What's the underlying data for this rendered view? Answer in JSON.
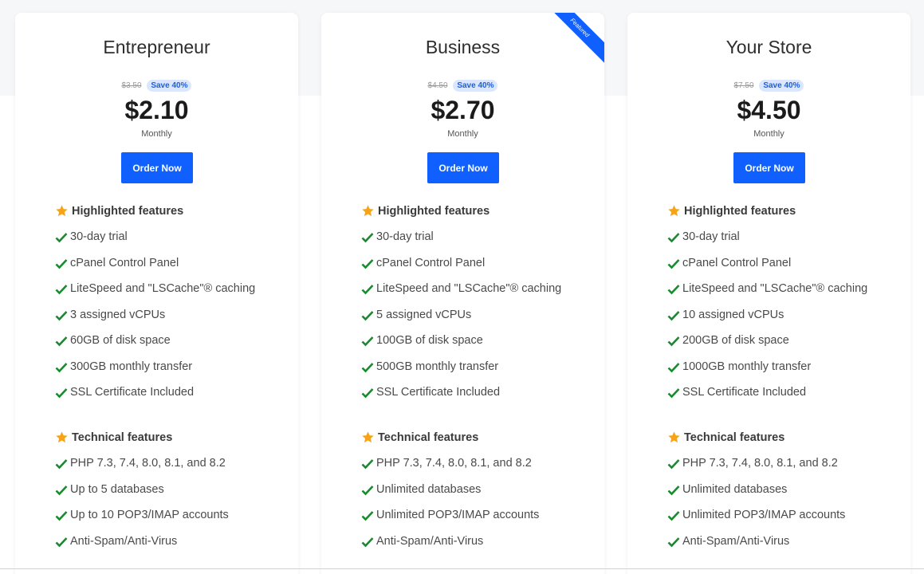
{
  "plans": [
    {
      "name": "Entrepreneur",
      "old_price": "$3.50",
      "save_label": "Save 40%",
      "price": "$2.10",
      "period": "Monthly",
      "order_label": "Order Now",
      "highlighted_title": "Highlighted features",
      "highlighted": [
        "30-day trial",
        "cPanel Control Panel",
        "LiteSpeed and \"LSCache\"® caching",
        "3 assigned vCPUs",
        "60GB of disk space",
        "300GB monthly transfer",
        "SSL Certificate Included"
      ],
      "technical_title": "Technical features",
      "technical": [
        "PHP 7.3, 7.4, 8.0, 8.1, and 8.2",
        "Up to 5 databases",
        "Up to 10 POP3/IMAP accounts",
        "Anti-Spam/Anti-Virus"
      ]
    },
    {
      "name": "Business",
      "ribbon": "Featured",
      "old_price": "$4.50",
      "save_label": "Save 40%",
      "price": "$2.70",
      "period": "Monthly",
      "order_label": "Order Now",
      "highlighted_title": "Highlighted features",
      "highlighted": [
        "30-day trial",
        "cPanel Control Panel",
        "LiteSpeed and \"LSCache\"® caching",
        "5 assigned vCPUs",
        "100GB of disk space",
        "500GB monthly transfer",
        "SSL Certificate Included"
      ],
      "technical_title": "Technical features",
      "technical": [
        "PHP 7.3, 7.4, 8.0, 8.1, and 8.2",
        "Unlimited databases",
        "Unlimited POP3/IMAP accounts",
        "Anti-Spam/Anti-Virus"
      ]
    },
    {
      "name": "Your Store",
      "old_price": "$7.50",
      "save_label": "Save 40%",
      "price": "$4.50",
      "period": "Monthly",
      "order_label": "Order Now",
      "highlighted_title": "Highlighted features",
      "highlighted": [
        "30-day trial",
        "cPanel Control Panel",
        "LiteSpeed and \"LSCache\"® caching",
        "10 assigned vCPUs",
        "200GB of disk space",
        "1000GB monthly transfer",
        "SSL Certificate Included"
      ],
      "technical_title": "Technical features",
      "technical": [
        "PHP 7.3, 7.4, 8.0, 8.1, and 8.2",
        "Unlimited databases",
        "Unlimited POP3/IMAP accounts",
        "Anti-Spam/Anti-Virus"
      ]
    }
  ],
  "icons": {
    "section": "star-icon",
    "feature": "check-icon"
  },
  "colors": {
    "accent": "#1060ff",
    "check": "#1a8a2e",
    "star": "#f5a31a",
    "badge_bg": "#dbe7ff",
    "badge_text": "#1f5fd6"
  }
}
